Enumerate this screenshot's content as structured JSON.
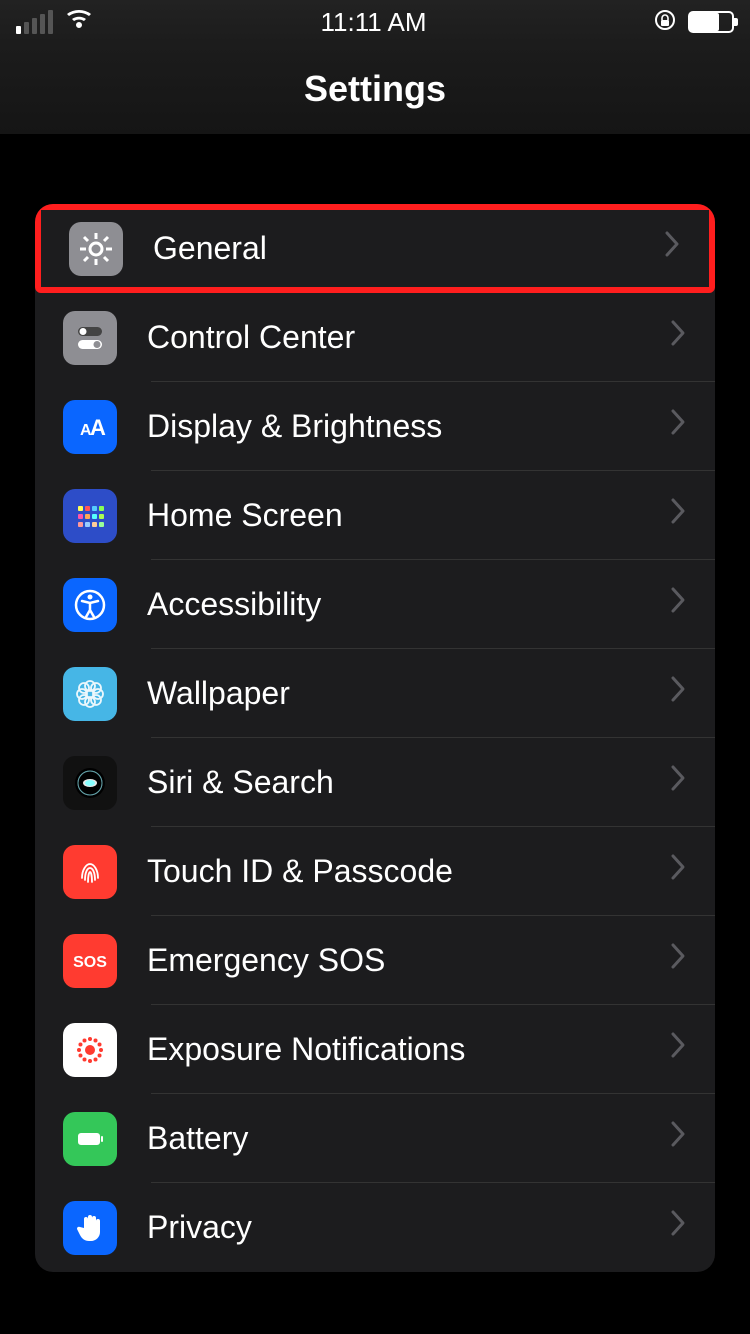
{
  "status": {
    "time": "11:11 AM"
  },
  "nav": {
    "title": "Settings"
  },
  "rows": [
    {
      "id": "general",
      "label": "General",
      "icon": "gear-icon",
      "color": "ic-gray",
      "highlighted": true
    },
    {
      "id": "control-center",
      "label": "Control Center",
      "icon": "toggles-icon",
      "color": "ic-gray2"
    },
    {
      "id": "display",
      "label": "Display & Brightness",
      "icon": "aa-icon",
      "color": "ic-blue"
    },
    {
      "id": "home-screen",
      "label": "Home Screen",
      "icon": "apps-icon",
      "color": "ic-indigo"
    },
    {
      "id": "accessibility",
      "label": "Accessibility",
      "icon": "accessibility-icon",
      "color": "ic-blue"
    },
    {
      "id": "wallpaper",
      "label": "Wallpaper",
      "icon": "flower-icon",
      "color": "ic-lightblue"
    },
    {
      "id": "siri",
      "label": "Siri & Search",
      "icon": "siri-icon",
      "color": "ic-dark"
    },
    {
      "id": "touchid",
      "label": "Touch ID & Passcode",
      "icon": "fingerprint-icon",
      "color": "ic-red"
    },
    {
      "id": "sos",
      "label": "Emergency SOS",
      "icon": "sos-icon",
      "color": "ic-red2"
    },
    {
      "id": "exposure",
      "label": "Exposure Notifications",
      "icon": "exposure-icon",
      "color": "ic-white"
    },
    {
      "id": "battery",
      "label": "Battery",
      "icon": "battery-icon",
      "color": "ic-green"
    },
    {
      "id": "privacy",
      "label": "Privacy",
      "icon": "hand-icon",
      "color": "ic-blue2"
    }
  ]
}
